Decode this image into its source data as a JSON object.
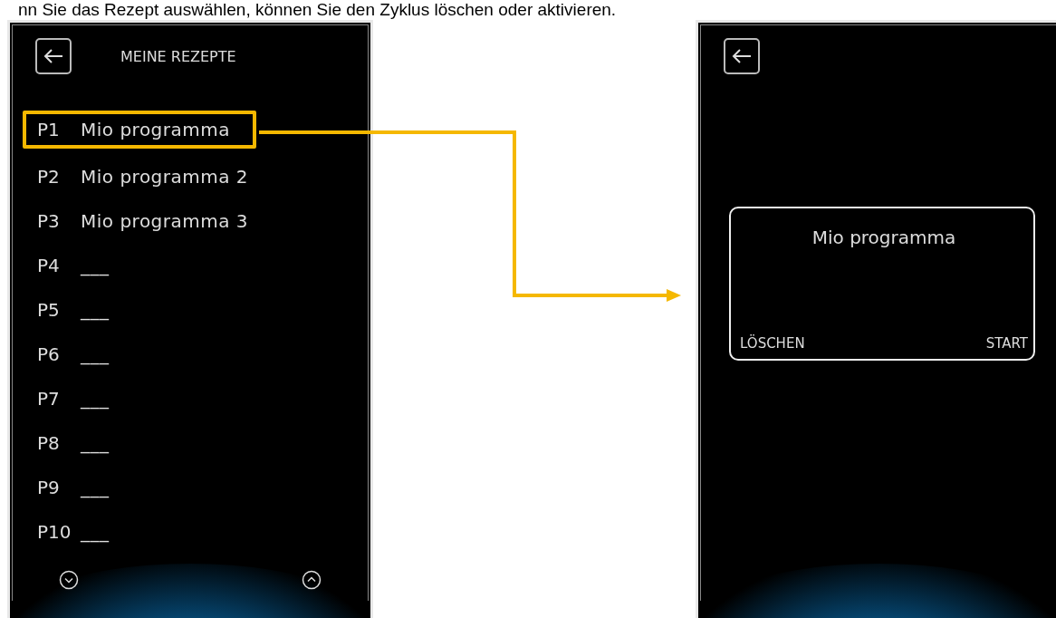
{
  "caption": "nn Sie das Rezept auswählen, können Sie den Zyklus löschen oder aktivieren.",
  "list_screen": {
    "title": "MEINE REZEPTE",
    "recipes": [
      {
        "slot": "P1",
        "name": "Mio programma",
        "selected": true
      },
      {
        "slot": "P2",
        "name": "Mio programma 2",
        "selected": false
      },
      {
        "slot": "P3",
        "name": "Mio programma 3",
        "selected": false
      },
      {
        "slot": "P4",
        "name": "___",
        "selected": false
      },
      {
        "slot": "P5",
        "name": "___",
        "selected": false
      },
      {
        "slot": "P6",
        "name": "___",
        "selected": false
      },
      {
        "slot": "P7",
        "name": "___",
        "selected": false
      },
      {
        "slot": "P8",
        "name": "___",
        "selected": false
      },
      {
        "slot": "P9",
        "name": "___",
        "selected": false
      },
      {
        "slot": "P10",
        "name": "___",
        "selected": false
      }
    ]
  },
  "detail_screen": {
    "recipe_name": "Mio programma",
    "actions": [
      "LÖSCHEN",
      "START"
    ]
  }
}
